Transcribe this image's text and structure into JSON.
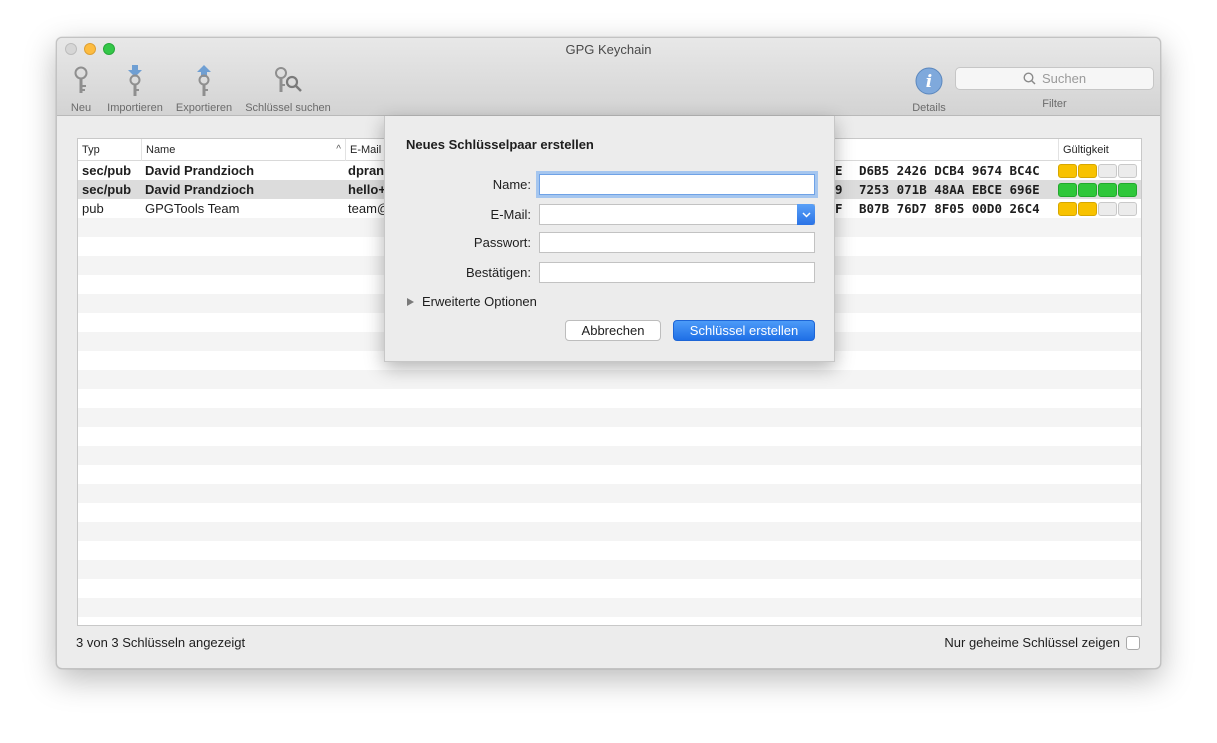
{
  "window": {
    "title": "GPG Keychain"
  },
  "toolbar": {
    "new": "Neu",
    "import": "Importieren",
    "export": "Exportieren",
    "search_keys": "Schlüssel suchen",
    "details": "Details",
    "filter": "Filter",
    "search_placeholder": "Suchen"
  },
  "table": {
    "columns": {
      "type": "Typ",
      "name": "Name",
      "email": "E-Mail",
      "validity": "Gültigkeit"
    },
    "rows": [
      {
        "type": "sec/pub",
        "name": "David Prandzioch",
        "email": "dpran",
        "fp_lead": "E",
        "fingerprint": "D6B5 2426 DCB4 9674 BC4C",
        "validity": 2,
        "color": "yellow"
      },
      {
        "type": "sec/pub",
        "name": "David Prandzioch",
        "email": "hello+",
        "fp_lead": "9",
        "fingerprint": "7253 071B 48AA EBCE 696E",
        "validity": 4,
        "color": "green"
      },
      {
        "type": "pub",
        "name": "GPGTools Team",
        "email": "team@",
        "fp_lead": "F",
        "fingerprint": "B07B 76D7 8F05 00D0 26C4",
        "validity": 2,
        "color": "yellow"
      }
    ]
  },
  "status": {
    "count": "3 von 3 Schlüsseln angezeigt",
    "secret_only": "Nur geheime Schlüssel zeigen"
  },
  "sheet": {
    "title": "Neues Schlüsselpaar erstellen",
    "name_label": "Name:",
    "email_label": "E-Mail:",
    "password_label": "Passwort:",
    "confirm_label": "Bestätigen:",
    "advanced": "Erweiterte Optionen",
    "cancel": "Abbrechen",
    "create": "Schlüssel erstellen"
  },
  "colors": {
    "accent": "#2a73e6",
    "valid_yellow": "#f8c200",
    "valid_green": "#2fc73a"
  }
}
